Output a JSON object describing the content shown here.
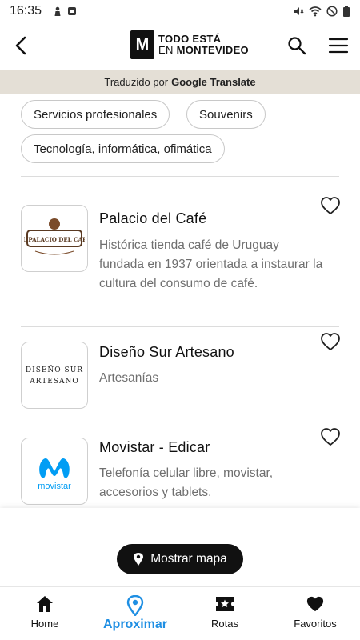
{
  "status_bar": {
    "time": "16:35"
  },
  "header": {
    "logo_mark": "M",
    "logo_line1": "TODO ESTÁ",
    "logo_line2_prefix": "EN ",
    "logo_line2_bold": "MONTEVIDEO"
  },
  "translate_banner": {
    "prefix": "Traduzido por",
    "brand": "Google Translate"
  },
  "chips": [
    "Servicios profesionales",
    "Souvenirs",
    "Tecnología, informática, ofimática"
  ],
  "items": [
    {
      "title": "Palacio del Café",
      "description": "Histórica tienda café de Uruguay fundada en 1937 orientada a instaurar la cultura del consumo de café.",
      "logo_text": "EL PALACIO DEL CAFE"
    },
    {
      "title": "Diseño Sur Artesano",
      "description": "Artesanías",
      "logo_line1": "DISEÑO SUR",
      "logo_line2": "ARTESANO"
    },
    {
      "title": "Movistar - Edicar",
      "description": "Telefonía celular libre, movistar, accesorios y tablets.",
      "logo_text": "movistar"
    }
  ],
  "map_button": {
    "label": "Mostrar mapa"
  },
  "bottom_nav": [
    {
      "label": "Home",
      "icon": "home-icon",
      "active": false
    },
    {
      "label": "Aproximar",
      "icon": "location-pin-icon",
      "active": true
    },
    {
      "label": "Rotas",
      "icon": "ticket-star-icon",
      "active": false
    },
    {
      "label": "Favoritos",
      "icon": "heart-icon",
      "active": false
    }
  ],
  "colors": {
    "accent": "#1f8fe3",
    "banner_bg": "#e4dfd6",
    "movistar_blue": "#019df4"
  }
}
